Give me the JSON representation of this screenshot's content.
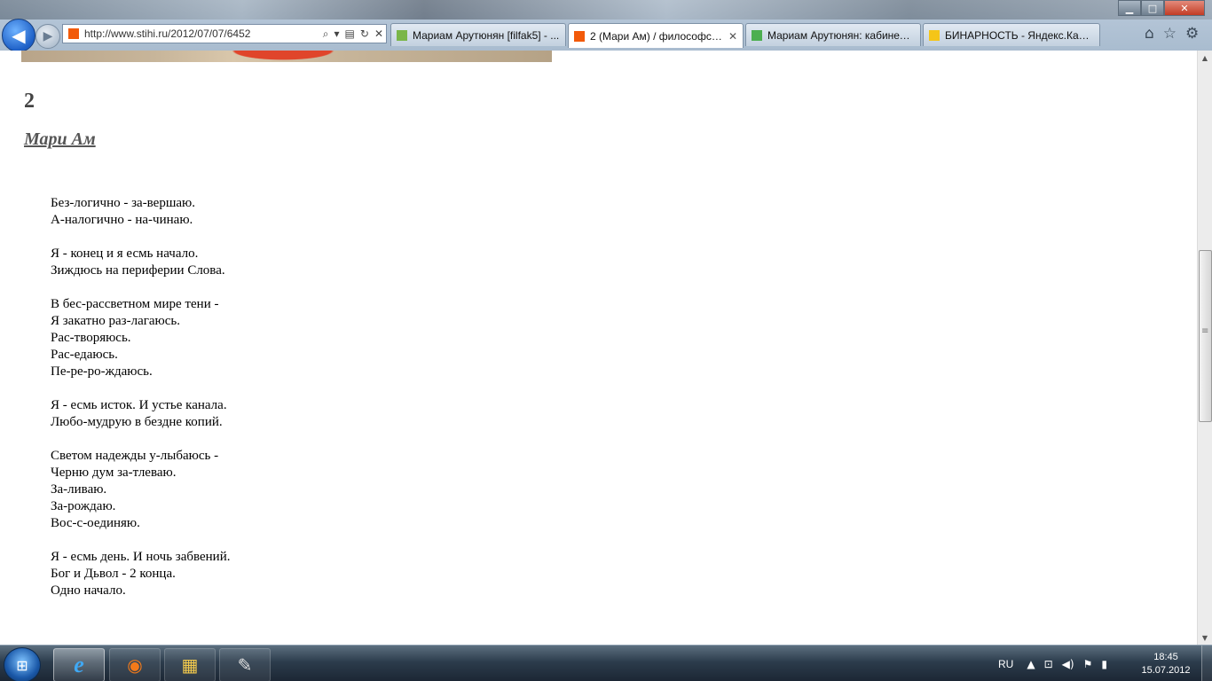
{
  "browser": {
    "address": "http://www.stihi.ru/2012/07/07/6452",
    "tabs": [
      {
        "label": "Мариам Арутюнян [filfak5] - ...",
        "favicon_color": "#7ab648",
        "active": false
      },
      {
        "label": "2 (Мари Ам) / философск...",
        "favicon_color": "#f25a0a",
        "active": true
      },
      {
        "label": "Мариам Арутюнян: кабинет ...",
        "favicon_color": "#4caf50",
        "active": false
      },
      {
        "label": "БИНАРНОСТЬ - Яндекс.Карт...",
        "favicon_color": "#f5c518",
        "active": false
      }
    ],
    "icons": {
      "back": "◀",
      "forward": "▶",
      "search": "⌕",
      "dropdown": "▾",
      "compat": "▤",
      "refresh": "↻",
      "stop": "✕",
      "home": "⌂",
      "favorites": "☆",
      "tools": "⚙",
      "tab_close": "✕",
      "minimize": "▁",
      "maximize": "□",
      "close": "✕"
    }
  },
  "page": {
    "title": "2",
    "author": "Мари Ам",
    "stanzas": [
      [
        "Без-логично - за-вершаю.",
        "А-налогично - на-чинаю."
      ],
      [
        "Я - конец и я есмь начало.",
        "Зиждюсь на периферии Слова."
      ],
      [
        "В бес-рассветном мире тени -",
        "Я закатно раз-лагаюсь.",
        "Рас-творяюсь.",
        "Рас-едаюсь.",
        "Пе-ре-ро-ждаюсь."
      ],
      [
        "Я - есмь исток. И устье канала.",
        "Любо-мудрую в бездне копий."
      ],
      [
        "Светом надежды у-лыбаюсь -",
        "Черню дум за-тлеваю.",
        "За-ливаю.",
        "За-рождаю.",
        "Вос-с-оединяю."
      ],
      [
        "Я - есмь день. И ночь забвений.",
        "Бог и Дьвол - 2 конца.",
        "Одно начало."
      ]
    ]
  },
  "scrollbar": {
    "position_fraction": 0.34
  },
  "taskbar": {
    "start_icon": "⊞",
    "apps": [
      {
        "name": "internet-explorer",
        "glyph": "e",
        "color": "#3fa9f5"
      },
      {
        "name": "firefox",
        "glyph": "◉",
        "color": "#f27a1a"
      },
      {
        "name": "explorer",
        "glyph": "▦",
        "color": "#f2c94c"
      },
      {
        "name": "paint",
        "glyph": "✎",
        "color": "#e0e0e0"
      }
    ],
    "language": "RU",
    "tray_icons": {
      "arrow": "▲",
      "network": "⊡",
      "volume": "◀)",
      "flag": "⚑",
      "power": "▮"
    },
    "time": "18:45",
    "date": "15.07.2012"
  }
}
